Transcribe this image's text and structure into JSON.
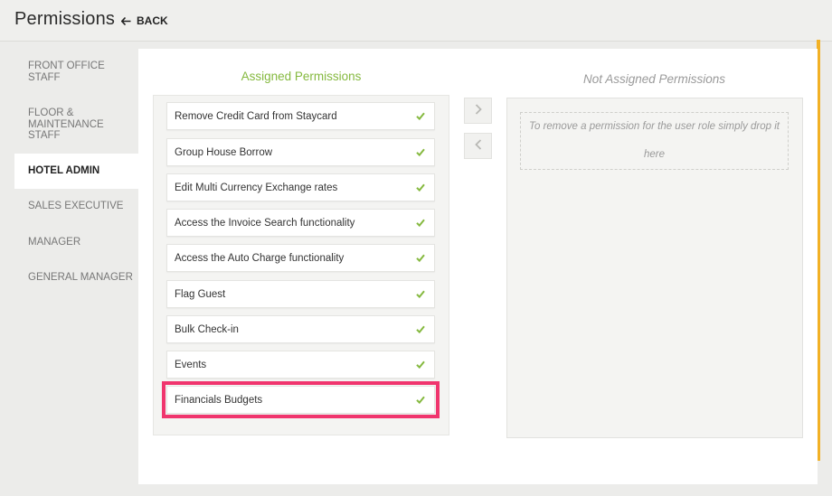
{
  "header": {
    "title": "Permissions",
    "back_label": "BACK"
  },
  "sidebar": {
    "items": [
      {
        "label": "FRONT OFFICE STAFF"
      },
      {
        "label": "FLOOR & MAINTENANCE STAFF"
      },
      {
        "label": "HOTEL ADMIN"
      },
      {
        "label": "SALES EXECUTIVE"
      },
      {
        "label": "MANAGER"
      },
      {
        "label": "GENERAL MANAGER"
      }
    ],
    "active": "HOTEL ADMIN"
  },
  "assigned": {
    "title": "Assigned Permissions",
    "items": [
      {
        "label": "Remove Credit Card from Staycard"
      },
      {
        "label": "Group House Borrow"
      },
      {
        "label": "Edit Multi Currency Exchange rates"
      },
      {
        "label": "Access the Invoice Search functionality"
      },
      {
        "label": "Access the Auto Charge functionality"
      },
      {
        "label": "Flag Guest"
      },
      {
        "label": "Bulk Check-in"
      },
      {
        "label": "Events"
      },
      {
        "label": "Financials Budgets"
      }
    ],
    "highlighted": "Financials Budgets"
  },
  "not_assigned": {
    "title": "Not Assigned Permissions",
    "drop_hint": "To remove a permission for the user role simply drop it here"
  },
  "colors": {
    "accent_green": "#85b93f",
    "highlight_pink": "#f0356e",
    "accent_bar": "#f2b125"
  },
  "icons": {
    "back": "arrow-left-icon",
    "check": "checkmark-icon",
    "move_right": "chevron-right-icon",
    "move_left": "chevron-left-icon"
  }
}
